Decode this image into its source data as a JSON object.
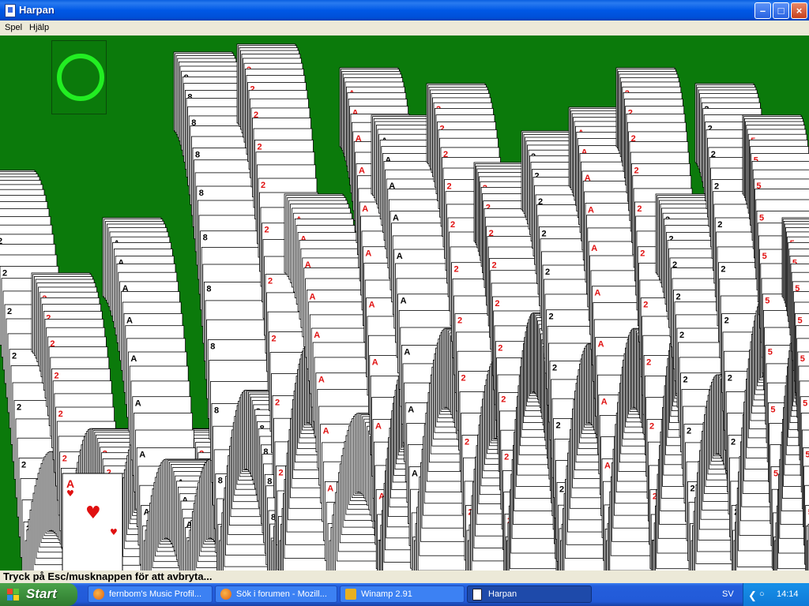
{
  "window": {
    "title": "Harpan"
  },
  "menu": {
    "items": [
      "Spel",
      "Hjälp"
    ]
  },
  "status": {
    "text": "Tryck på Esc/musknappen för att avbryta..."
  },
  "taskbar": {
    "start_label": "Start",
    "tasks": [
      {
        "label": "fernbom's Music Profil...",
        "icon": "firefox-icon"
      },
      {
        "label": "Sök i forumen - Mozill...",
        "icon": "firefox-icon"
      },
      {
        "label": "Winamp 2.91",
        "icon": "winamp-icon"
      },
      {
        "label": "Harpan",
        "icon": "solitaire-icon"
      }
    ],
    "language": "SV",
    "clock": "14:14"
  },
  "colors": {
    "felt": "#0b7a0b",
    "ring": "#22ee22",
    "card_red": "#e01010"
  },
  "cards": {
    "ace_rank": "A",
    "two_rank": "2",
    "five_rank": "5",
    "eight_rank": "8"
  }
}
